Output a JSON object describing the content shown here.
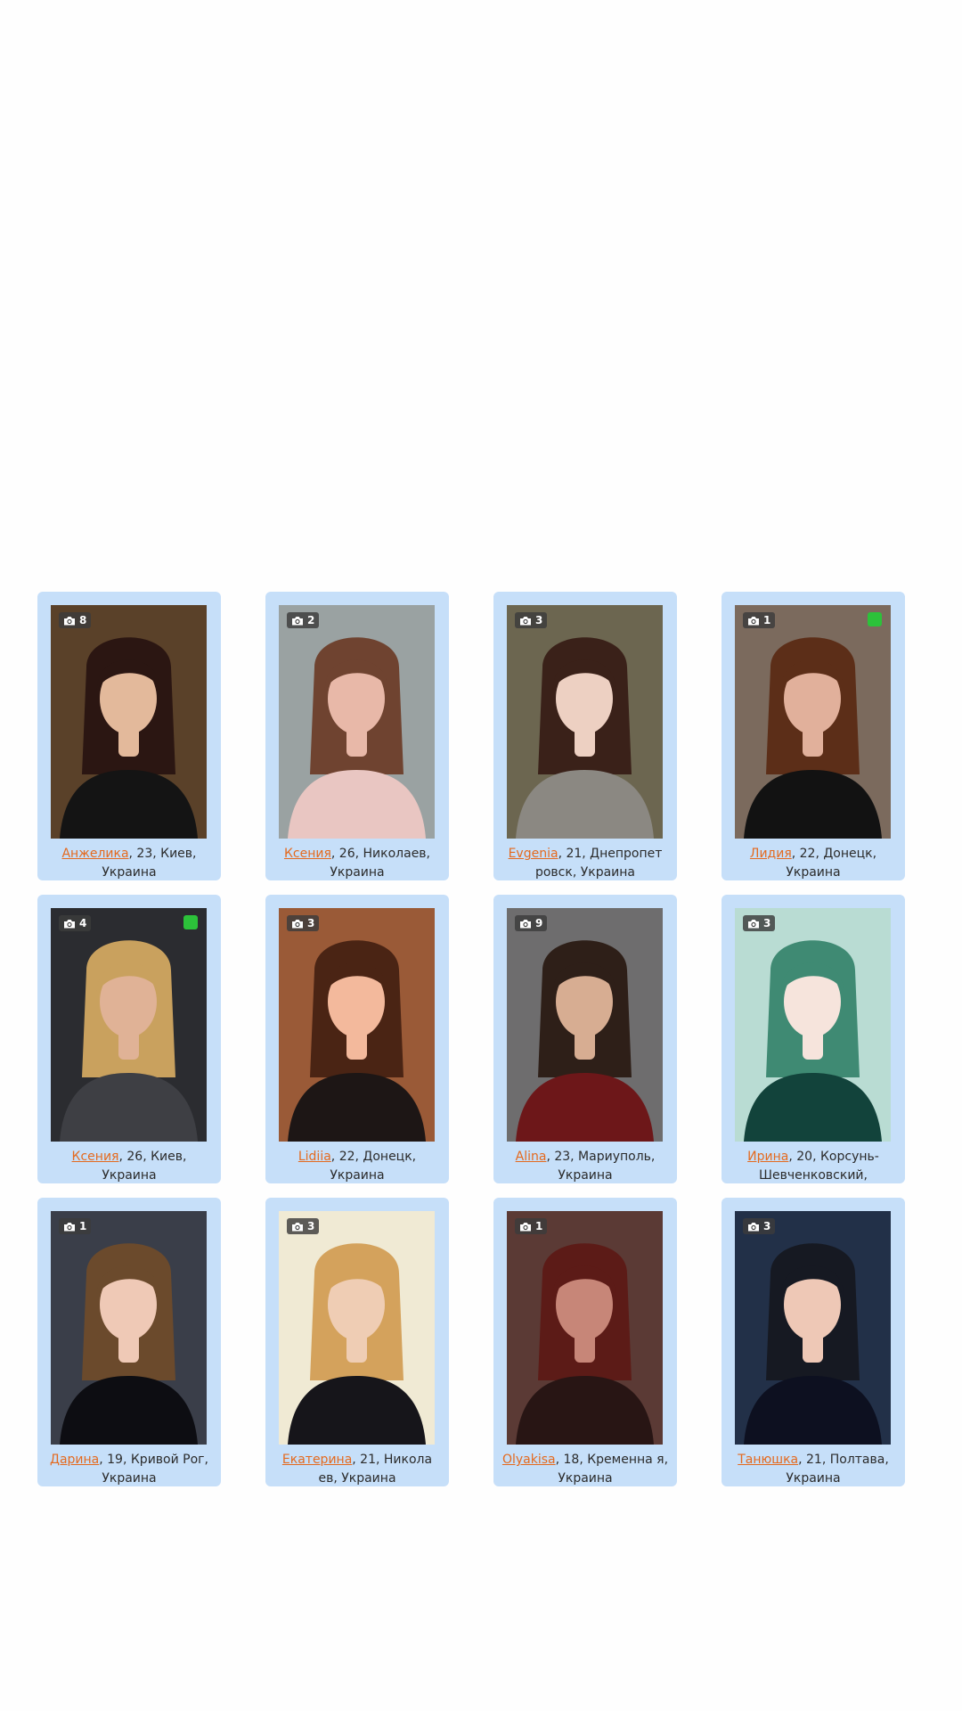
{
  "profiles": [
    {
      "name": "Анжелика",
      "details": ", 23, Киев, Украина",
      "photos": "8",
      "online": false,
      "bg": "#5a4129",
      "skin": "#e3b99b",
      "hair": "#2b1612",
      "top": "#141414"
    },
    {
      "name": "Ксения",
      "details": ", 26, Николаев, Украина",
      "photos": "2",
      "online": false,
      "bg": "#9aa2a2",
      "skin": "#e8b8a8",
      "hair": "#6f4330",
      "top": "#e9c6c2"
    },
    {
      "name": "Evgenia",
      "details": ", 21, Днепропет ровск, Украина",
      "photos": "3",
      "online": false,
      "bg": "#6c6650",
      "skin": "#edd0c2",
      "hair": "#3a2119",
      "top": "#8b8882"
    },
    {
      "name": "Лидия",
      "details": ", 22, Донецк, Украина",
      "photos": "1",
      "online": true,
      "bg": "#7b6a5d",
      "skin": "#e1b09b",
      "hair": "#5c2e18",
      "top": "#121212"
    },
    {
      "name": "Ксения",
      "details": ", 26, Киев, Украина",
      "photos": "4",
      "online": true,
      "bg": "#2b2c30",
      "skin": "#e0b296",
      "hair": "#c9a15e",
      "top": "#3e3f44"
    },
    {
      "name": "Lidiia",
      "details": ", 22, Донецк, Украина",
      "photos": "3",
      "online": false,
      "bg": "#9a5a37",
      "skin": "#f3b99c",
      "hair": "#4a2414",
      "top": "#1d1615"
    },
    {
      "name": "Alina",
      "details": ", 23, Мариуполь, Украина",
      "photos": "9",
      "online": false,
      "bg": "#6e6d6e",
      "skin": "#d7ad92",
      "hair": "#2e1f18",
      "top": "#6d1719"
    },
    {
      "name": "Ирина",
      "details": ", 20, Корсунь-Шевченковский,",
      "photos": "3",
      "online": false,
      "bg": "#b9dcd3",
      "skin": "#f6e4dc",
      "hair": "#3f8a73",
      "top": "#12433b"
    },
    {
      "name": "Дарина",
      "details": ", 19, Кривой Рог, Украина",
      "photos": "1",
      "online": false,
      "bg": "#3a3e49",
      "skin": "#efc9b6",
      "hair": "#6b4a2c",
      "top": "#0d0d12"
    },
    {
      "name": "Екатерина",
      "details": ", 21, Никола ев, Украина",
      "photos": "3",
      "online": false,
      "bg": "#f0ead4",
      "skin": "#efcdb4",
      "hair": "#d4a25c",
      "top": "#16151a"
    },
    {
      "name": "Olyakisa",
      "details": ", 18, Кременна я, Украина",
      "photos": "1",
      "online": false,
      "bg": "#5b3a35",
      "skin": "#c78678",
      "hair": "#5c1b17",
      "top": "#281514"
    },
    {
      "name": "Танюшка",
      "details": ", 21, Полтава, Украина",
      "photos": "3",
      "online": false,
      "bg": "#223048",
      "skin": "#eec8b6",
      "hair": "#161922",
      "top": "#0d1020"
    }
  ]
}
